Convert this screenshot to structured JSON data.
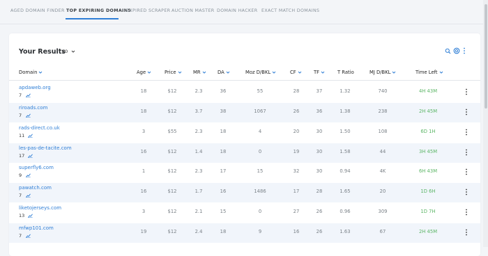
{
  "nav": {
    "tabs": [
      {
        "label": "AGED DOMAIN FINDER"
      },
      {
        "label": "TOP EXPIRING DOMAINS"
      },
      {
        "label": "EXPIRED SCRAPER"
      },
      {
        "label": "AUCTION MASTER"
      },
      {
        "label": "DOMAIN HACKER"
      },
      {
        "label": "EXACT MATCH DOMAINS"
      }
    ],
    "active_tab": "TOP EXPIRING DOMAINS"
  },
  "results": {
    "title": "Your Results",
    "per_page": "20",
    "icons": [
      "search-icon",
      "settings-icon",
      "more-vertical-icon"
    ]
  },
  "table": {
    "columns": [
      "Domain",
      "Age",
      "Price",
      "MR",
      "DA",
      "Moz D/BKL",
      "CF",
      "TF",
      "T Ratio",
      "MJ D/BKL",
      "Time Left"
    ],
    "rows": [
      {
        "domain": "apdaweb.org",
        "count": "7",
        "age": "18",
        "price": "$12",
        "mr": "2.3",
        "da": "36",
        "moz": "55",
        "cf": "28",
        "tf": "37",
        "tratio": "1.32",
        "mj": "740",
        "time": "4H 43M"
      },
      {
        "domain": "riroads.com",
        "count": "7",
        "age": "18",
        "price": "$12",
        "mr": "3.7",
        "da": "38",
        "moz": "1067",
        "cf": "26",
        "tf": "36",
        "tratio": "1.38",
        "mj": "238",
        "time": "2H 45M"
      },
      {
        "domain": "rads-direct.co.uk",
        "count": "11",
        "age": "3",
        "price": "$55",
        "mr": "2.3",
        "da": "18",
        "moz": "4",
        "cf": "20",
        "tf": "30",
        "tratio": "1.50",
        "mj": "108",
        "time": "6D 1H"
      },
      {
        "domain": "les-pas-de-tacite.com",
        "count": "17",
        "age": "16",
        "price": "$12",
        "mr": "1.4",
        "da": "18",
        "moz": "0",
        "cf": "19",
        "tf": "30",
        "tratio": "1.58",
        "mj": "44",
        "time": "3H 45M"
      },
      {
        "domain": "superfly6.com",
        "count": "9",
        "age": "1",
        "price": "$12",
        "mr": "2.3",
        "da": "17",
        "moz": "15",
        "cf": "32",
        "tf": "30",
        "tratio": "0.94",
        "mj": "4K",
        "time": "6H 43M"
      },
      {
        "domain": "pawatch.com",
        "count": "7",
        "age": "16",
        "price": "$12",
        "mr": "1.7",
        "da": "16",
        "moz": "1486",
        "cf": "17",
        "tf": "28",
        "tratio": "1.65",
        "mj": "20",
        "time": "1D 6H"
      },
      {
        "domain": "liketojerseys.com",
        "count": "13",
        "age": "3",
        "price": "$12",
        "mr": "2.1",
        "da": "15",
        "moz": "0",
        "cf": "27",
        "tf": "26",
        "tratio": "0.96",
        "mj": "309",
        "time": "1D 7H"
      },
      {
        "domain": "mfwp101.com",
        "count": "7",
        "age": "19",
        "price": "$12",
        "mr": "2.4",
        "da": "18",
        "moz": "9",
        "cf": "16",
        "tf": "26",
        "tratio": "1.63",
        "mj": "67",
        "time": "2H 45M"
      }
    ]
  },
  "colors": {
    "accent": "#2e7ed6",
    "time_left": "#5bb566",
    "row_alt": "#f1f5fb"
  }
}
